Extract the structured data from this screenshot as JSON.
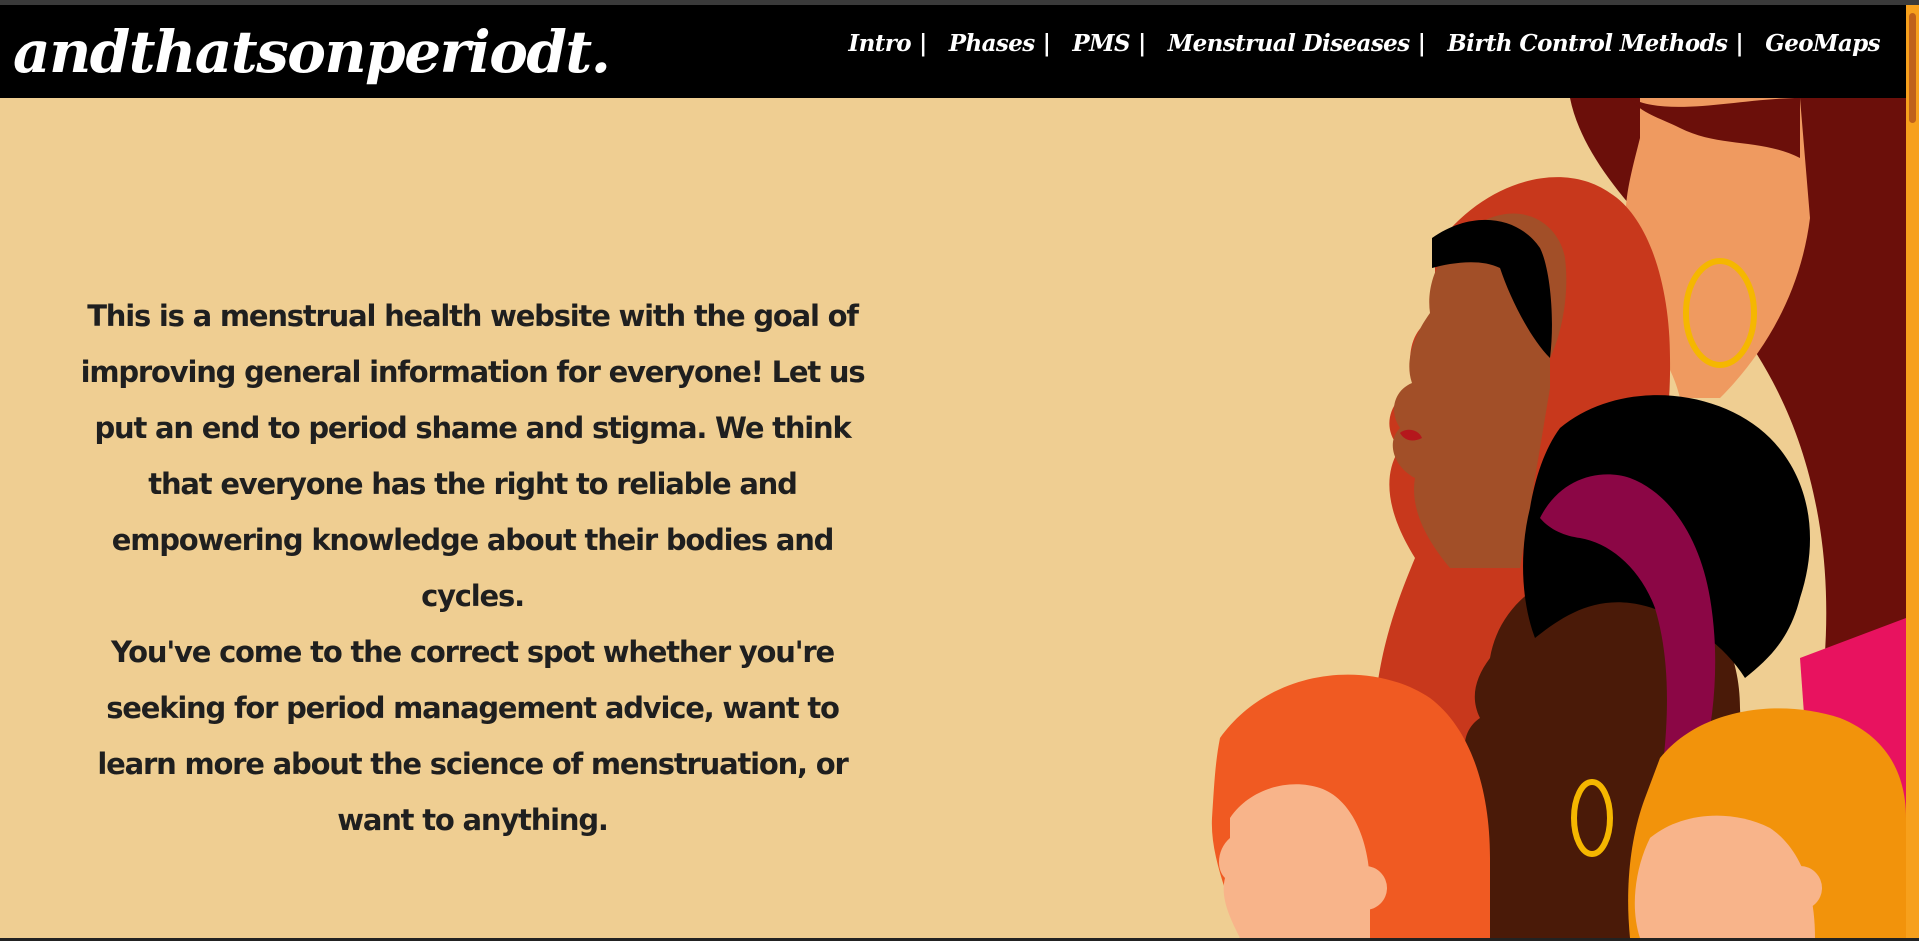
{
  "site": {
    "logo": "andthatsonperiodt."
  },
  "nav": {
    "items": [
      {
        "label": "Intro",
        "sep": "|"
      },
      {
        "label": "Phases",
        "sep": "|"
      },
      {
        "label": "PMS",
        "sep": "|"
      },
      {
        "label": "Menstrual Diseases",
        "sep": "|"
      },
      {
        "label": "Birth Control Methods",
        "sep": "|"
      },
      {
        "label": "GeoMaps",
        "sep": ""
      }
    ]
  },
  "hero": {
    "paragraph1": "This is a menstrual health website with the goal of improving general information for everyone! Let us put an end to period shame and stigma.  We think that everyone has the right to reliable and empowering knowledge about their bodies and cycles.",
    "paragraph2": "You've come to the correct spot whether you're seeking for period management advice, want to learn more about the science of menstruation, or want to anything.",
    "background_color": "#efce92"
  },
  "colors": {
    "navbar": "#000000",
    "scrollbar": "#f7a01c",
    "text": "#1f1f1f"
  }
}
